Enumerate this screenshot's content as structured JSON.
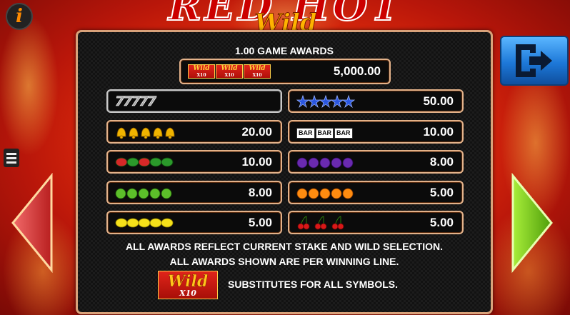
{
  "title": {
    "brand": "RED HOT",
    "sub": "Wild"
  },
  "header": {
    "info_label": "i"
  },
  "paytable": {
    "heading": "1.00 GAME AWARDS",
    "top_award": {
      "symbol": "wild-x10-icon",
      "count": 3,
      "tile_text": "Wild",
      "tile_mult": "X10",
      "value": "5,000.00"
    },
    "left_column": [
      {
        "symbol": "seven-icon",
        "count": 5,
        "glyph": "77777",
        "value": ""
      },
      {
        "symbol": "bell-icon",
        "count": 5,
        "color": "#f0b400",
        "value": "20.00"
      },
      {
        "symbol": "watermelon-icon",
        "count": 5,
        "color": "#2b9a2b",
        "value": "10.00"
      },
      {
        "symbol": "lime-icon",
        "count": 5,
        "color": "#5cbf2a",
        "value": "8.00"
      },
      {
        "symbol": "lemon-icon",
        "count": 5,
        "color": "#f5e11a",
        "value": "5.00"
      }
    ],
    "right_column": [
      {
        "symbol": "star-icon",
        "count": 5,
        "color": "#2a56e0",
        "value": "50.00"
      },
      {
        "symbol": "bar-icon",
        "count": 3,
        "glyph": "BAR",
        "value": "10.00"
      },
      {
        "symbol": "plum-icon",
        "count": 5,
        "color": "#6a2ab0",
        "value": "8.00"
      },
      {
        "symbol": "orange-icon",
        "count": 5,
        "color": "#ff8c10",
        "value": "5.00"
      },
      {
        "symbol": "cherry-icon",
        "count": 3,
        "color": "#d81818",
        "value": "5.00"
      }
    ],
    "note_line1": "ALL AWARDS REFLECT CURRENT STAKE AND WILD SELECTION.",
    "note_line2": "ALL AWARDS SHOWN ARE PER WINNING LINE.",
    "wild_tile": {
      "text": "Wild",
      "mult": "X10"
    },
    "wild_note": "SUBSTITUTES FOR ALL SYMBOLS."
  },
  "colors": {
    "panel_border": "#d9a27a",
    "exit_blue": "#1d78d8",
    "arrow_left": "#d63a3a",
    "arrow_right": "#7fd21a"
  }
}
